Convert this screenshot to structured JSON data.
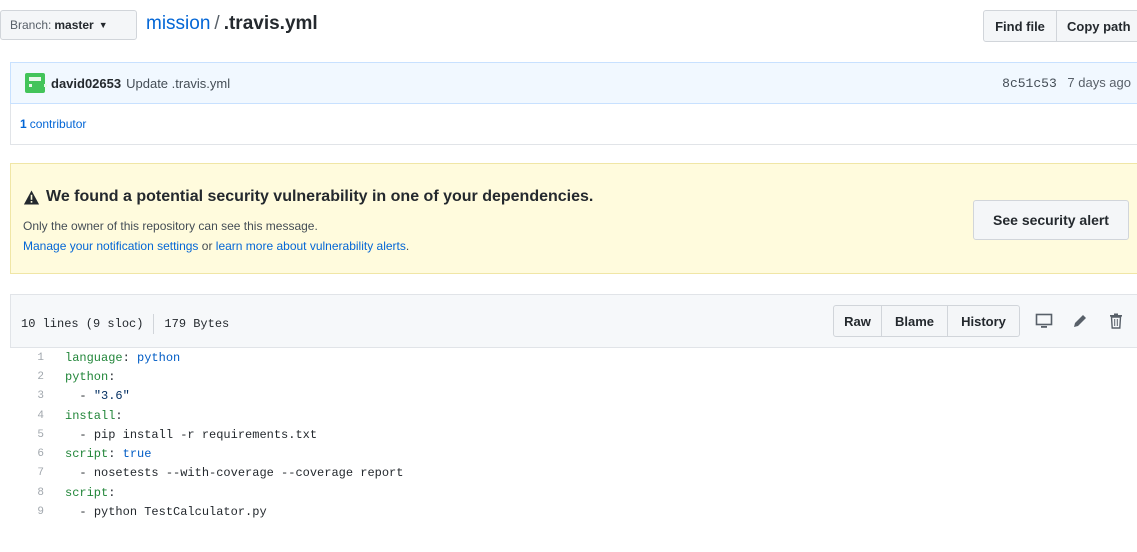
{
  "branch": {
    "label": "Branch:",
    "value": "master"
  },
  "breadcrumb": {
    "repo": "mission",
    "separator": "/",
    "file": ".travis.yml"
  },
  "file_nav": {
    "find_file": "Find file",
    "copy_path": "Copy path"
  },
  "commit": {
    "author": "david02653",
    "message": "Update .travis.yml",
    "sha": "8c51c53",
    "time_ago": "7 days ago"
  },
  "contributors": {
    "count": "1",
    "label": "contributor"
  },
  "alert": {
    "title": "We found a potential security vulnerability in one of your dependencies.",
    "owner_note": "Only the owner of this repository can see this message.",
    "link_manage": "Manage your notification settings",
    "connector": " or ",
    "link_learn": "learn more about vulnerability alerts",
    "end": ".",
    "button": "See security alert"
  },
  "file_header": {
    "lines": "10 lines (9 sloc)",
    "size": "179 Bytes",
    "raw": "Raw",
    "blame": "Blame",
    "history": "History"
  },
  "code_lines": [
    {
      "num": "1",
      "key": "language",
      "sep": ": ",
      "val": "python",
      "val_type": "v"
    },
    {
      "num": "2",
      "key": "python",
      "sep": ":",
      "val": "",
      "val_type": "v"
    },
    {
      "num": "3",
      "key": "",
      "sep": "  - ",
      "val": "\"3.6\"",
      "val_type": "s"
    },
    {
      "num": "4",
      "key": "install",
      "sep": ":",
      "val": "",
      "val_type": "v"
    },
    {
      "num": "5",
      "key": "",
      "sep": "  - ",
      "val": "pip install -r requirements.txt",
      "val_type": "p"
    },
    {
      "num": "6",
      "key": "script",
      "sep": ": ",
      "val": "true",
      "val_type": "v"
    },
    {
      "num": "7",
      "key": "",
      "sep": "  - ",
      "val": "nosetests --with-coverage --coverage report",
      "val_type": "p"
    },
    {
      "num": "8",
      "key": "script",
      "sep": ":",
      "val": "",
      "val_type": "v"
    },
    {
      "num": "9",
      "key": "",
      "sep": "  - ",
      "val": "python TestCalculator.py",
      "val_type": "p"
    }
  ],
  "colors": {
    "link": "#0366d6",
    "commit_bg": "#f1f8ff",
    "alert_bg": "#fffbdd",
    "avatar": "#43c45a"
  },
  "icons": {
    "warning": "alert-triangle-icon",
    "desktop": "desktop-icon",
    "edit": "pencil-icon",
    "delete": "trashcan-icon"
  }
}
